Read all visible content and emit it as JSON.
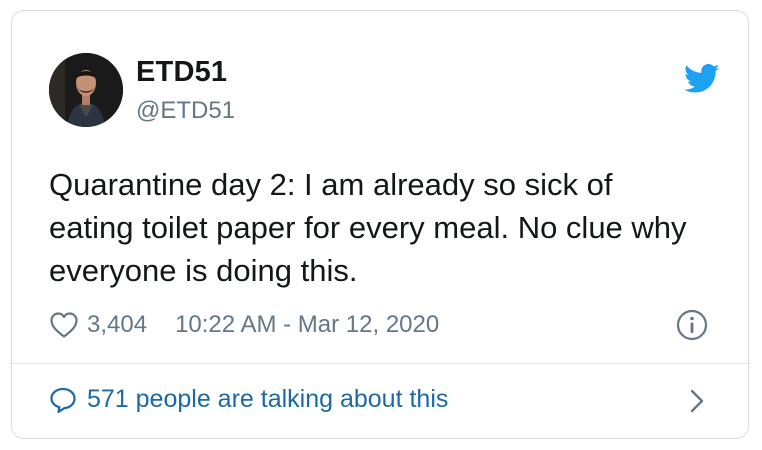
{
  "tweet": {
    "display_name": "ETD51",
    "handle": "@ETD51",
    "text_lines": [
      "Quarantine day 2: I am already so sick of",
      "eating toilet paper for every meal. No clue why",
      "everyone is doing this."
    ],
    "likes": "3,404",
    "timestamp": "10:22 AM - Mar 12, 2020",
    "talking": "571 people are talking about this"
  },
  "icons": {
    "brand": "twitter-bird-icon",
    "like": "heart-icon",
    "info": "info-icon",
    "reply": "speech-bubble-icon",
    "more": "chevron-right-icon"
  },
  "colors": {
    "text": "#14171a",
    "secondary": "#657786",
    "link": "#1b6aa5",
    "brand": "#1da1f2",
    "border": "#d9dee2"
  }
}
